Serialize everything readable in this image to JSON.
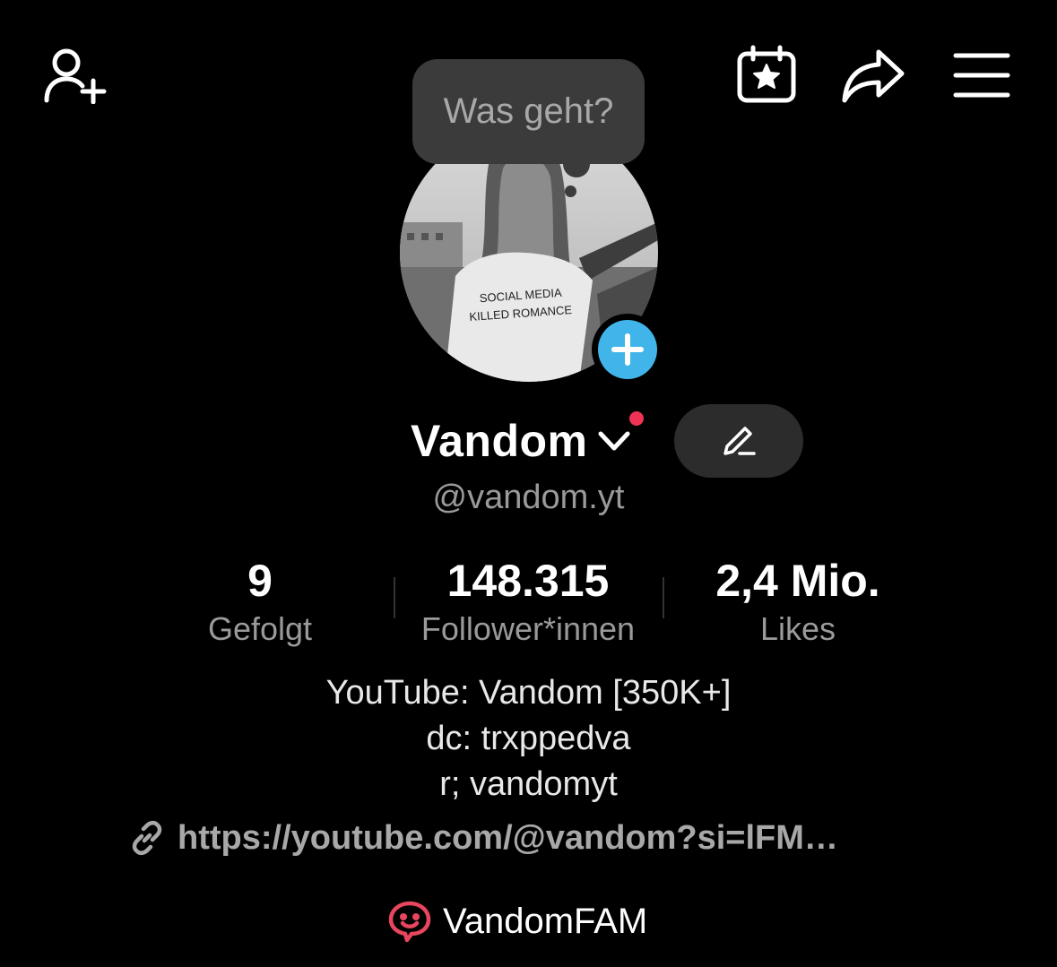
{
  "header": {
    "icons": [
      "add-friend-icon",
      "calendar-star-icon",
      "share-icon",
      "menu-icon"
    ]
  },
  "bubble": {
    "text": "Was geht?"
  },
  "avatar": {
    "shirt_line1": "SOCIAL MEDIA",
    "shirt_line2": "KILLED ROMANCE"
  },
  "profile": {
    "display_name": "Vandom",
    "username": "@vandom.yt"
  },
  "stats": [
    {
      "value": "9",
      "label": "Gefolgt"
    },
    {
      "value": "148.315",
      "label": "Follower*innen"
    },
    {
      "value": "2,4 Mio.",
      "label": "Likes"
    }
  ],
  "bio": {
    "lines": [
      "YouTube: Vandom [350K+]",
      "dc: trxppedva",
      "r; vandomyt"
    ],
    "link": "https://youtube.com/@vandom?si=lFM…"
  },
  "group": {
    "name": "VandomFAM"
  },
  "colors": {
    "accent_blue": "#41b4ea",
    "notification_red": "#ee3355",
    "group_pink": "#e8465e"
  }
}
